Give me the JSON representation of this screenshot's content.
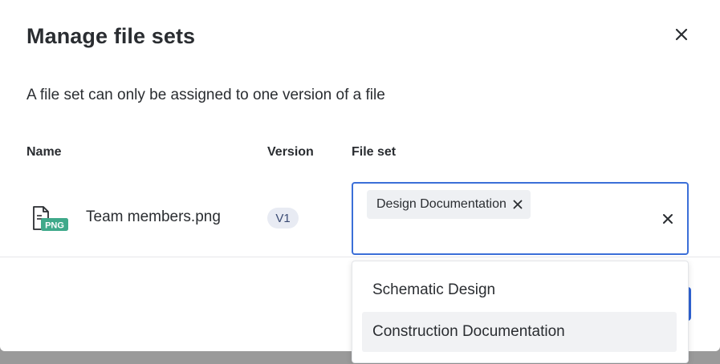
{
  "dialog": {
    "title": "Manage file sets",
    "subtitle": "A file set can only be assigned to one version of a file"
  },
  "table": {
    "headers": {
      "name": "Name",
      "version": "Version",
      "file_set": "File set"
    },
    "rows": [
      {
        "file_name": "Team members.png",
        "file_type_badge": "PNG",
        "version": "V1",
        "file_sets": [
          "Design Documentation"
        ]
      }
    ]
  },
  "dropdown": {
    "options": [
      {
        "label": "Schematic Design",
        "highlighted": false
      },
      {
        "label": "Construction Documentation",
        "highlighted": true
      }
    ]
  },
  "icons": {
    "close": "close-icon",
    "file": "png-file-icon",
    "chip_remove": "remove-icon",
    "clear": "clear-icon"
  },
  "colors": {
    "focus_border": "#3b6fd8",
    "png_badge": "#3fa98a",
    "primary_button": "#2f63d4",
    "version_badge_bg": "#e8ebf3"
  }
}
